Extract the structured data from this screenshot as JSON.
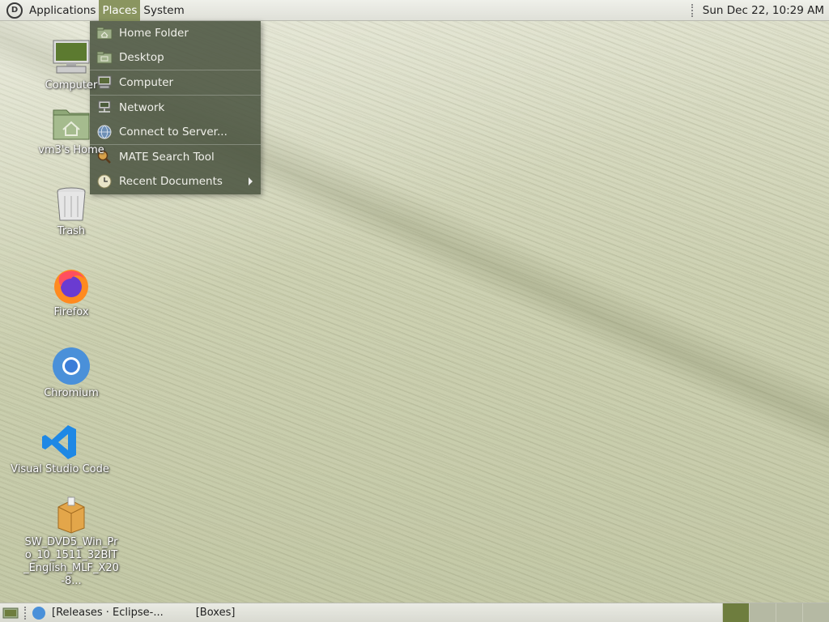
{
  "top_panel": {
    "applications_label": "Applications",
    "places_label": "Places",
    "system_label": "System",
    "clock": "Sun Dec 22, 10:29 AM"
  },
  "places_menu": {
    "items": [
      {
        "label": "Home Folder",
        "icon": "home-folder-icon"
      },
      {
        "label": "Desktop",
        "icon": "desktop-folder-icon"
      },
      {
        "label": "Computer",
        "icon": "computer-icon"
      },
      {
        "label": "Network",
        "icon": "network-icon"
      },
      {
        "label": "Connect to Server...",
        "icon": "globe-icon"
      },
      {
        "label": "MATE Search Tool",
        "icon": "search-icon"
      },
      {
        "label": "Recent Documents",
        "icon": "clock-icon"
      }
    ]
  },
  "desktop_icons": [
    {
      "label": "Computer"
    },
    {
      "label": "vm3's Home"
    },
    {
      "label": "Trash"
    },
    {
      "label": "Firefox"
    },
    {
      "label": "Chromium"
    },
    {
      "label": "Visual Studio Code"
    },
    {
      "label": "SW_DVD5_Win_Pro_10_1511_32BIT_English_MLF_X20-8..."
    }
  ],
  "taskbar": {
    "tasks": [
      {
        "label": "[Releases · Eclipse-..."
      },
      {
        "label": "[Boxes]"
      }
    ]
  },
  "colors": {
    "menu_active": "#8a9560",
    "menu_bg": "#46503c",
    "workspace_active": "#6e7d3e"
  }
}
